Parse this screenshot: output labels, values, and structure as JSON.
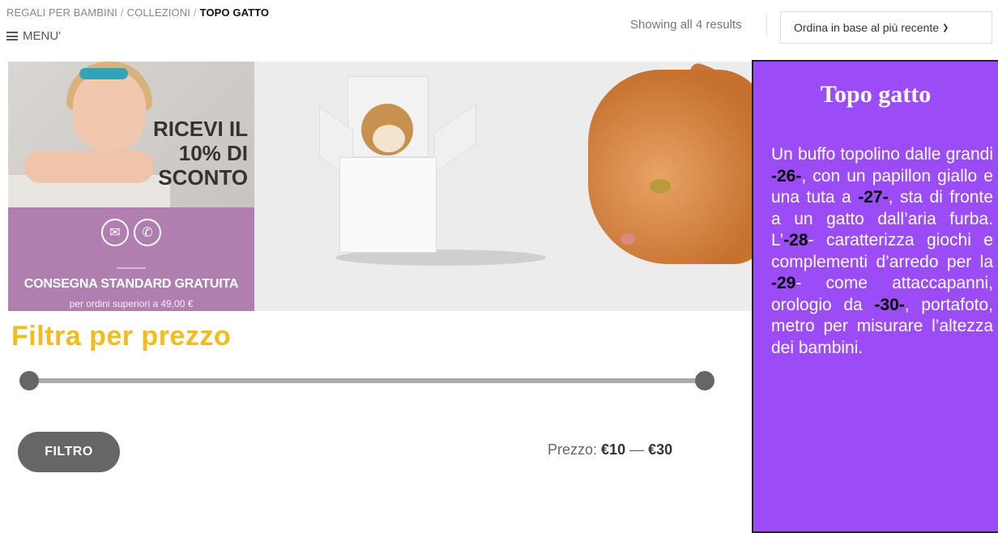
{
  "breadcrumb": {
    "item1": "REGALI PER BAMBINI",
    "item2": "COLLEZIONI",
    "current": "TOPO GATTO",
    "separator": "/"
  },
  "menu": {
    "label": "MENU'"
  },
  "results": {
    "text": "Showing all 4 results"
  },
  "sort": {
    "selected": "Ordina in base al più recente"
  },
  "promo": {
    "line1": "RICEVI IL",
    "line2": "10% DI",
    "line3": "SCONTO",
    "shipping": "CONSEGNA STANDARD GRATUITA",
    "minimum": "per ordini superiori a 49,00 €",
    "icons": [
      "envelope-icon",
      "phone-icon"
    ]
  },
  "filter": {
    "title": "Filtra per prezzo",
    "button": "FILTRO",
    "price_label": "Prezzo:",
    "price_min": "€10",
    "price_dash": "—",
    "price_max": "€30"
  },
  "panel": {
    "title": "Topo gatto",
    "t1": "Un buffo topolino dalle grandi ",
    "b1": "-26-",
    "t2": ", con un papillon giallo e una tuta a ",
    "b2": "-27-",
    "t3": ", sta di fronte a un gatto dall’aria furba. L’",
    "b3": "-28",
    "t4": "- caratterizza giochi e complementi d’arredo per la ",
    "b4": "-29",
    "t5": "- come attaccapanni, orologio da ",
    "b5": "-30-",
    "t6": ", portafoto, metro per misurare l’altezza dei bambini."
  },
  "colors": {
    "accent_yellow": "#f3bb1c",
    "promo_purple": "#b07fb0",
    "panel_purple": "#9c4cf7",
    "button_gray": "#666666"
  }
}
